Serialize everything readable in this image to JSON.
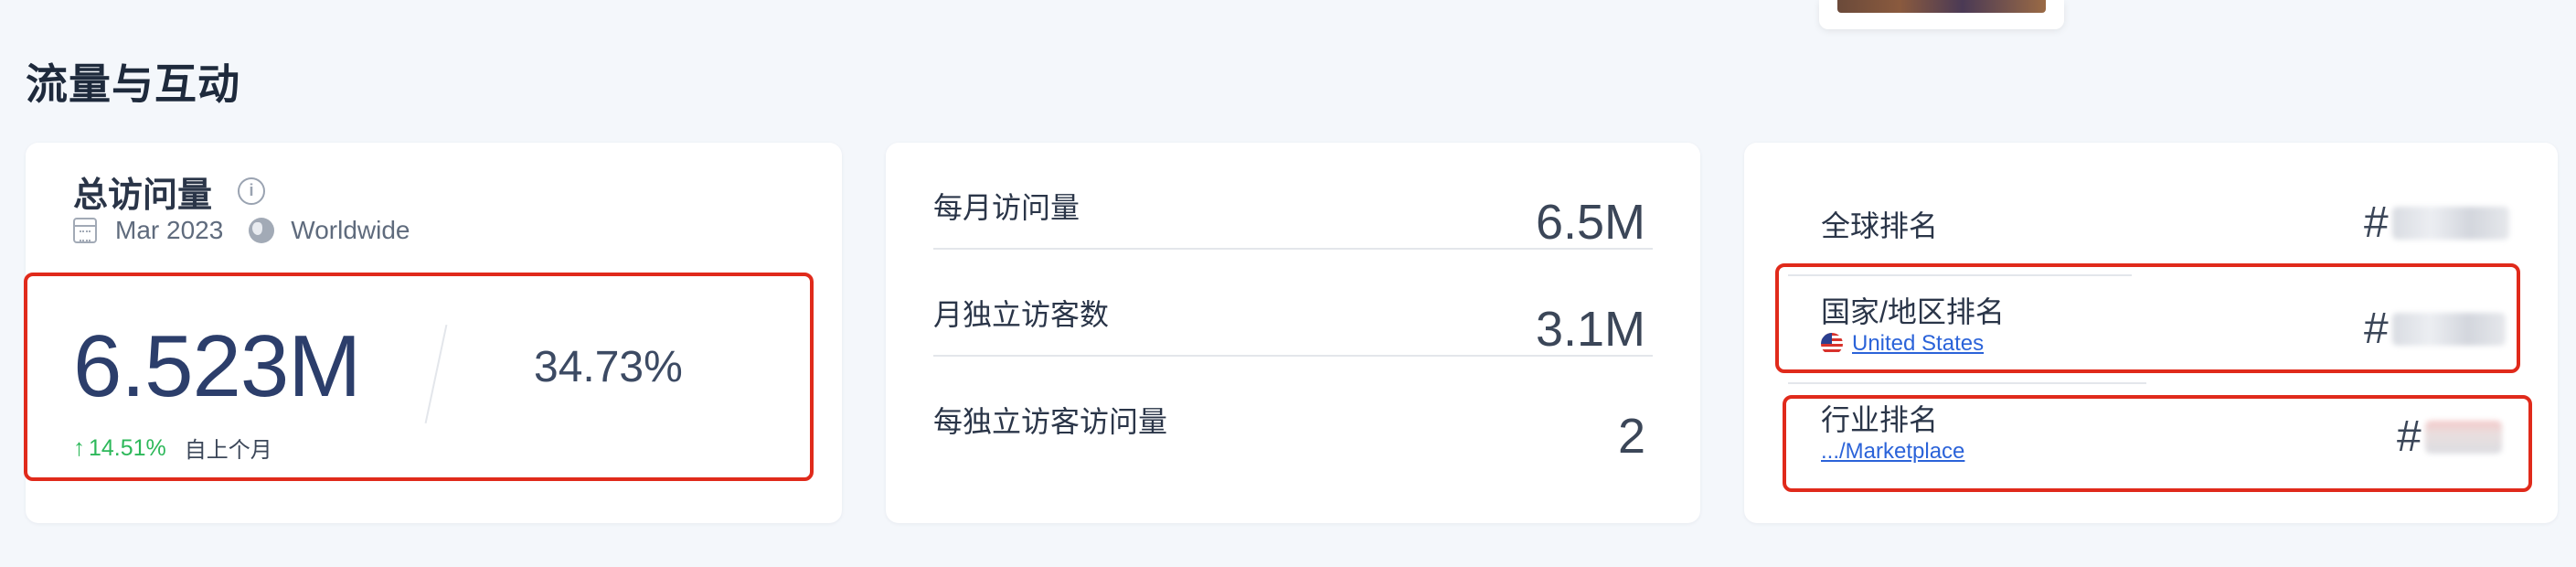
{
  "section": {
    "title": "流量与互动"
  },
  "total_visits": {
    "title": "总访问量",
    "period": "Mar 2023",
    "region": "Worldwide",
    "value": "6.523M",
    "share": "34.73%",
    "change": "14.51%",
    "change_label": "自上个月"
  },
  "metrics": [
    {
      "label": "每月访问量",
      "value": "6.5M"
    },
    {
      "label": "月独立访客数",
      "value": "3.1M"
    },
    {
      "label": "每独立访客访问量",
      "value": "2"
    }
  ],
  "ranks": {
    "global": {
      "label": "全球排名",
      "prefix": "#"
    },
    "country": {
      "label": "国家/地区排名",
      "link": "United States",
      "prefix": "#"
    },
    "industry": {
      "label": "行业排名",
      "link": ".../Marketplace",
      "prefix": "#"
    }
  },
  "colors": {
    "highlight": "#e02a1b",
    "positive": "#2db85a",
    "link": "#2b63d9",
    "main_value": "#2c3e6b"
  }
}
